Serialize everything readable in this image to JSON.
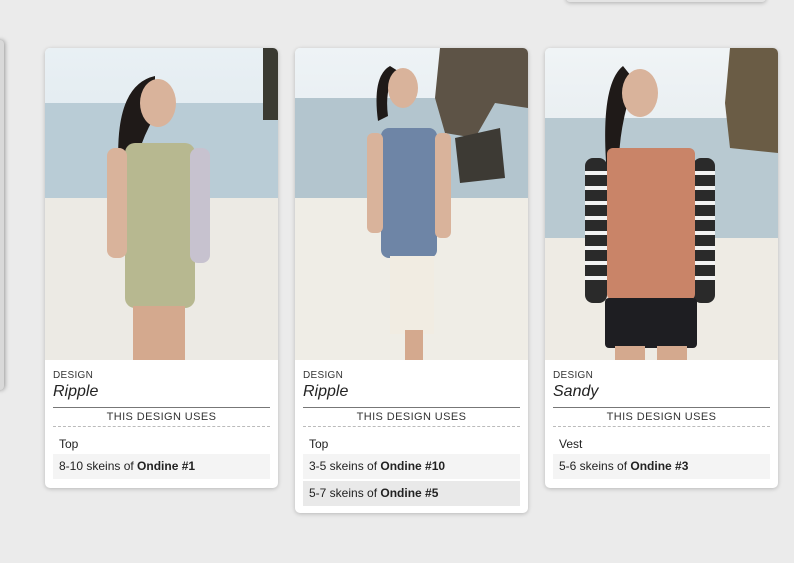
{
  "cards": [
    {
      "design_label": "DESIGN",
      "name": "Ripple",
      "uses_header": "THIS DESIGN USES",
      "garment": "Top",
      "yarns": [
        {
          "prefix": "8-10 skeins of ",
          "yarn": "Ondine #1"
        }
      ],
      "sweater_color": "#b7b890"
    },
    {
      "design_label": "DESIGN",
      "name": "Ripple",
      "uses_header": "THIS DESIGN USES",
      "garment": "Top",
      "yarns": [
        {
          "prefix": "3-5 skeins of ",
          "yarn": "Ondine #10"
        },
        {
          "prefix": "5-7 skeins of ",
          "yarn": "Ondine #5"
        }
      ],
      "sweater_color": "#6e85a6"
    },
    {
      "design_label": "DESIGN",
      "name": "Sandy",
      "uses_header": "THIS DESIGN USES",
      "garment": "Vest",
      "yarns": [
        {
          "prefix": "5-6 skeins of ",
          "yarn": "Ondine #3"
        }
      ],
      "sweater_color": "#c98468"
    }
  ]
}
